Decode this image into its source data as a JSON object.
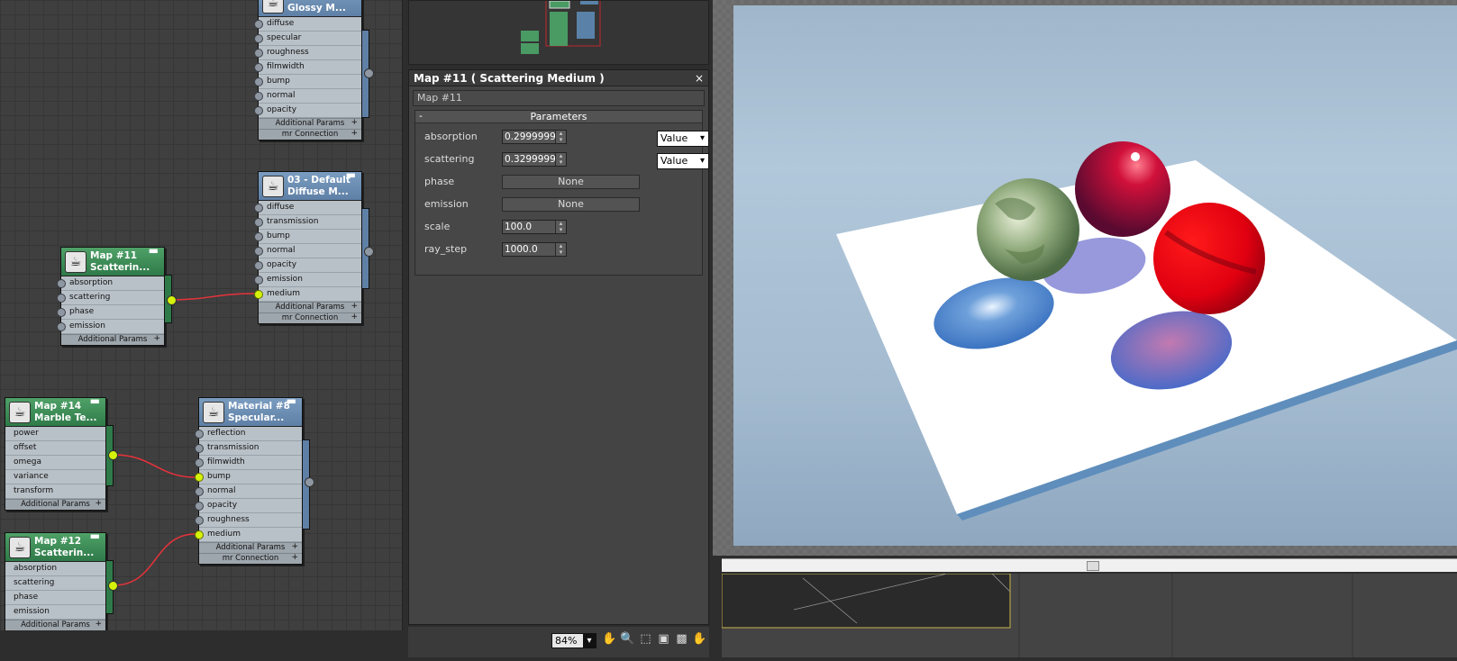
{
  "node_editor": {
    "nodes": [
      {
        "id": "glossy",
        "title": "...\nGlossy M...",
        "color": "blue",
        "slots": [
          "diffuse",
          "specular",
          "roughness",
          "filmwidth",
          "bump",
          "normal",
          "opacity"
        ],
        "footers": [
          "Additional Params",
          "mr Connection"
        ]
      },
      {
        "id": "default",
        "title": "03 - Default\nDiffuse  M...",
        "color": "blue",
        "slots": [
          "diffuse",
          "transmission",
          "bump",
          "normal",
          "opacity",
          "emission",
          "medium"
        ],
        "footers": [
          "Additional Params",
          "mr Connection"
        ]
      },
      {
        "id": "map11",
        "title": "Map #11\nScatterin...",
        "color": "green",
        "slots": [
          "absorption",
          "scattering",
          "phase",
          "emission"
        ],
        "footers": [
          "Additional Params"
        ]
      },
      {
        "id": "map14",
        "title": "Map #14\nMarble Te...",
        "color": "green",
        "slots": [
          "power",
          "offset",
          "omega",
          "variance",
          "transform"
        ],
        "footers": [
          "Additional Params"
        ]
      },
      {
        "id": "mat8",
        "title": "Material #8\nSpecular...",
        "color": "blue",
        "slots": [
          "reflection",
          "transmission",
          "filmwidth",
          "bump",
          "normal",
          "opacity",
          "roughness",
          "medium"
        ],
        "footers": [
          "Additional Params",
          "mr Connection"
        ]
      },
      {
        "id": "map12",
        "title": "Map #12\nScatterin...",
        "color": "green",
        "slots": [
          "absorption",
          "scattering",
          "phase",
          "emission"
        ],
        "footers": [
          "Additional Params"
        ]
      }
    ]
  },
  "param_panel": {
    "title": "Map #11  ( Scattering Medium )",
    "close": "×",
    "map_name": "Map #11",
    "rollout": {
      "collapse": "-",
      "title": "Parameters"
    },
    "params": [
      {
        "label": "absorption",
        "value": "0.2999999",
        "dropdown": "Value"
      },
      {
        "label": "scattering",
        "value": "0.3299999",
        "dropdown": "Value"
      },
      {
        "label": "phase",
        "button": "None"
      },
      {
        "label": "emission",
        "button": "None"
      },
      {
        "label": "scale",
        "value": "100.0"
      },
      {
        "label": "ray_step",
        "value": "1000.0"
      }
    ]
  },
  "status": {
    "zoom": "84%"
  },
  "colors": {
    "wire": "#e8323a",
    "socket_active": "#d4f20a",
    "node_blue": "#6a8cb3",
    "node_green": "#3a8a56"
  }
}
